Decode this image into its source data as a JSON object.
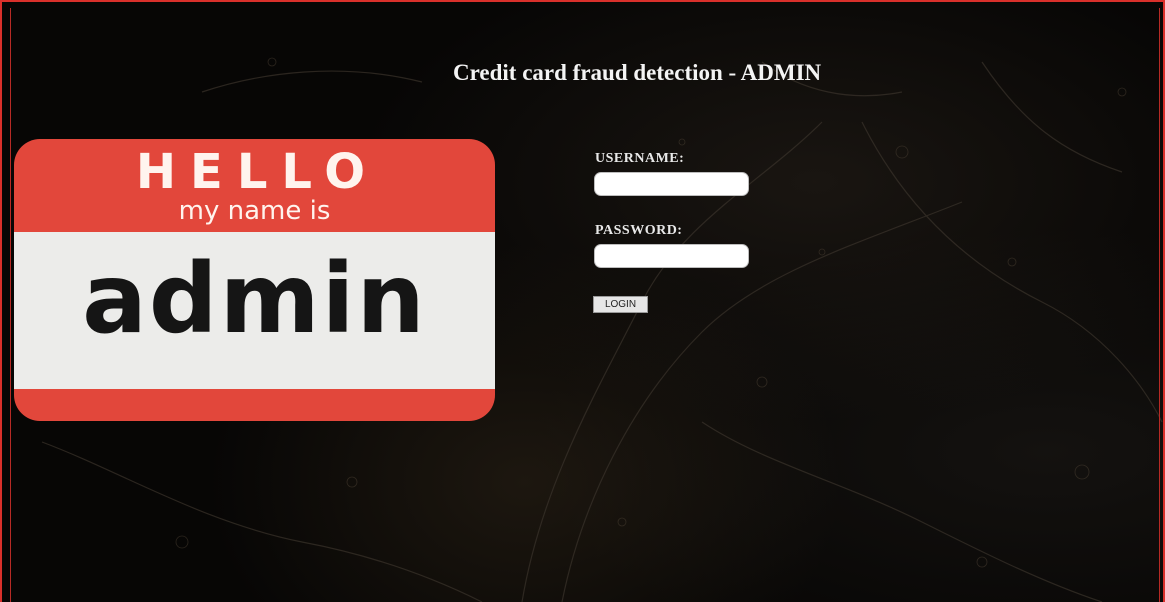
{
  "header": {
    "title": "Credit card fraud detection - ADMIN"
  },
  "badge": {
    "greeting": "HELLO",
    "subtitle": "my name is",
    "name": "admin"
  },
  "login_form": {
    "username_label": "USERNAME:",
    "username_value": "",
    "password_label": "PASSWORD:",
    "password_value": "",
    "login_label": "LOGIN"
  },
  "colors": {
    "frame_border": "#d9302b",
    "badge_red": "#e2473b",
    "badge_white": "#ececea",
    "background": "#070605"
  }
}
